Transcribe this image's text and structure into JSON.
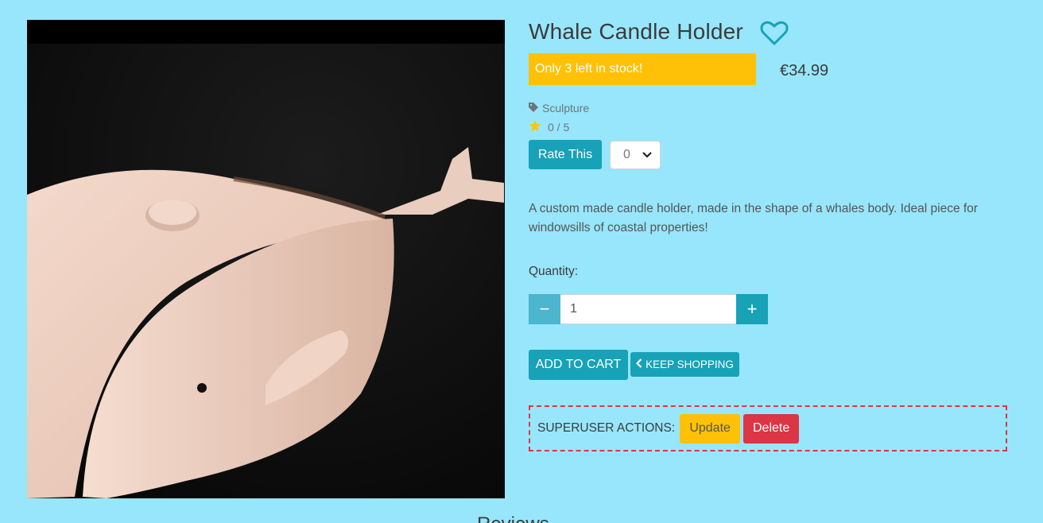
{
  "product": {
    "title": "Whale Candle Holder",
    "stock_message": "Only 3 left in stock!",
    "price": "€34.99",
    "category": "Sculpture",
    "rating_display": "0 / 5",
    "description": "A custom made candle holder, made in the shape of a whales body. Ideal piece for windowsills of coastal properties!",
    "image_alt": "Whale Candle Holder"
  },
  "rating_form": {
    "button_label": "Rate This",
    "selected_value": "0"
  },
  "quantity": {
    "label": "Quantity:",
    "value": "1",
    "minus_symbol": "−",
    "plus_symbol": "+"
  },
  "actions": {
    "add_to_cart": "ADD TO CART",
    "keep_shopping": "KEEP SHOPPING"
  },
  "superuser": {
    "label": "SUPERUSER ACTIONS:",
    "update_label": "Update",
    "delete_label": "Delete"
  },
  "reviews": {
    "heading": "Reviews"
  },
  "colors": {
    "page_background": "#97e6fb",
    "teal_button": "#17a2b8",
    "warning": "#ffc107",
    "danger": "#dc3545"
  },
  "icons": {
    "wishlist": "heart-outline-icon",
    "category": "tag-icon",
    "rating": "star-icon",
    "select": "chevron-down-icon",
    "keep_shopping": "chevron-left-icon"
  }
}
